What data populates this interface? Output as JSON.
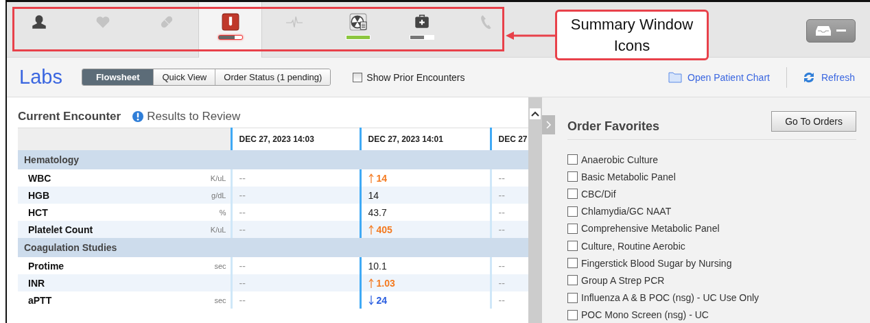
{
  "summary_icons": [
    {
      "kind": "person",
      "selected": false,
      "disabled": false
    },
    {
      "kind": "heart",
      "selected": false,
      "disabled": true
    },
    {
      "kind": "pill",
      "selected": false,
      "disabled": true
    },
    {
      "kind": "labs",
      "selected": true,
      "disabled": false,
      "level": 0.7,
      "color": "#666666"
    },
    {
      "kind": "ecg",
      "selected": false,
      "disabled": true
    },
    {
      "kind": "radiology",
      "selected": false,
      "disabled": false,
      "level": 1,
      "color": "#8cc63f"
    },
    {
      "kind": "medkit",
      "selected": false,
      "disabled": false,
      "level": 0.6,
      "color": "#777777"
    },
    {
      "kind": "phone",
      "selected": false,
      "disabled": true
    }
  ],
  "callout": {
    "text": "Summary Window Icons"
  },
  "header": {
    "title": "Labs",
    "views": [
      {
        "label": "Flowsheet",
        "selected": true
      },
      {
        "label": "Quick View",
        "selected": false
      },
      {
        "label": "Order Status (1 pending)",
        "selected": false
      }
    ],
    "prior_encounters": {
      "label": "Show Prior Encounters",
      "checked": false
    },
    "open_chart": "Open Patient Chart",
    "refresh": "Refresh"
  },
  "encounter": {
    "title": "Current Encounter",
    "review": "Results to Review",
    "columns": [
      "DEC 27, 2023 14:03",
      "DEC 27, 2023 14:01",
      "DEC 27"
    ],
    "sections": [
      {
        "name": "Hematology",
        "rows": [
          {
            "label": "WBC",
            "unit": "K/uL",
            "values": [
              {
                "text": "--",
                "kind": "normal"
              },
              {
                "text": "14",
                "kind": "high"
              },
              {
                "text": "--",
                "kind": "normal"
              }
            ]
          },
          {
            "label": "HGB",
            "unit": "g/dL",
            "values": [
              {
                "text": "--",
                "kind": "normal"
              },
              {
                "text": "14",
                "kind": "normal"
              },
              {
                "text": "--",
                "kind": "normal"
              }
            ]
          },
          {
            "label": "HCT",
            "unit": "%",
            "values": [
              {
                "text": "--",
                "kind": "normal"
              },
              {
                "text": "43.7",
                "kind": "normal"
              },
              {
                "text": "--",
                "kind": "normal"
              }
            ]
          },
          {
            "label": "Platelet Count",
            "unit": "K/uL",
            "values": [
              {
                "text": "--",
                "kind": "normal"
              },
              {
                "text": "405",
                "kind": "high"
              },
              {
                "text": "--",
                "kind": "normal"
              }
            ]
          }
        ]
      },
      {
        "name": "Coagulation Studies",
        "rows": [
          {
            "label": "Protime",
            "unit": "sec",
            "values": [
              {
                "text": "--",
                "kind": "normal"
              },
              {
                "text": "10.1",
                "kind": "normal"
              },
              {
                "text": "--",
                "kind": "normal"
              }
            ]
          },
          {
            "label": "INR",
            "values": [
              {
                "text": "--",
                "kind": "normal"
              },
              {
                "text": "1.03",
                "kind": "high"
              },
              {
                "text": "--",
                "kind": "normal"
              }
            ]
          },
          {
            "label": "aPTT",
            "unit": "sec",
            "values": [
              {
                "text": "--",
                "kind": "normal"
              },
              {
                "text": "24",
                "kind": "low"
              },
              {
                "text": "--",
                "kind": "normal"
              }
            ]
          }
        ]
      }
    ]
  },
  "order_favorites": {
    "title": "Order Favorites",
    "button": "Go To Orders",
    "items": [
      {
        "label": "Anaerobic Culture",
        "checked": false
      },
      {
        "label": "Basic Metabolic Panel",
        "checked": false
      },
      {
        "label": "CBC/Dif",
        "checked": false
      },
      {
        "label": "Chlamydia/GC NAAT",
        "checked": false
      },
      {
        "label": "Comprehensive Metabolic Panel",
        "checked": false
      },
      {
        "label": "Culture, Routine Aerobic",
        "checked": false
      },
      {
        "label": "Fingerstick Blood Sugar by Nursing",
        "checked": false
      },
      {
        "label": "Group A Strep PCR",
        "checked": false
      },
      {
        "label": "Influenza A & B POC (nsg) - UC Use Only",
        "checked": false
      },
      {
        "label": "POC Mono Screen (nsg) - UC",
        "checked": false
      }
    ]
  }
}
